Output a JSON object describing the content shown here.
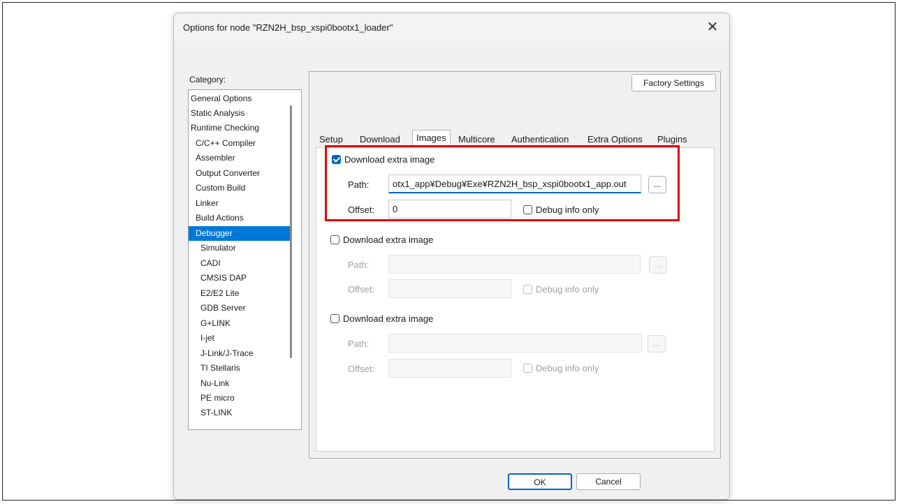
{
  "dialog": {
    "title": "Options for node \"RZN2H_bsp_xspi0bootx1_loader\"",
    "close_glyph": "✕",
    "ok_label": "OK",
    "cancel_label": "Cancel"
  },
  "category": {
    "label": "Category:",
    "items": [
      "General Options",
      "Static Analysis",
      "Runtime Checking",
      "C/C++ Compiler",
      "Assembler",
      "Output Converter",
      "Custom Build",
      "Linker",
      "Build Actions",
      "Debugger",
      "Simulator",
      "CADI",
      "CMSIS DAP",
      "E2/E2 Lite",
      "GDB Server",
      "G+LINK",
      "I-jet",
      "J-Link/J-Trace",
      "TI Stellaris",
      "Nu-Link",
      "PE micro",
      "ST-LINK"
    ],
    "selected": "Debugger"
  },
  "panel": {
    "factory_settings_label": "Factory Settings",
    "tabs": [
      "Setup",
      "Download",
      "Images",
      "Multicore",
      "Authentication",
      "Extra Options",
      "Plugins"
    ],
    "active_tab": "Images"
  },
  "images": [
    {
      "checkbox_label": "Download extra image",
      "checked": true,
      "path_label": "Path:",
      "path_value": "otx1_app¥Debug¥Exe¥RZN2H_bsp_xspi0bootx1_app.out",
      "offset_label": "Offset:",
      "offset_value": "0",
      "debug_label": "Debug info only",
      "browse_label": "...",
      "enabled": true
    },
    {
      "checkbox_label": "Download extra image",
      "checked": false,
      "path_label": "Path:",
      "path_value": "",
      "offset_label": "Offset:",
      "offset_value": "",
      "debug_label": "Debug info only",
      "browse_label": "...",
      "enabled": false
    },
    {
      "checkbox_label": "Download extra image",
      "checked": false,
      "path_label": "Path:",
      "path_value": "",
      "offset_label": "Offset:",
      "offset_value": "",
      "debug_label": "Debug info only",
      "browse_label": "...",
      "enabled": false
    }
  ]
}
